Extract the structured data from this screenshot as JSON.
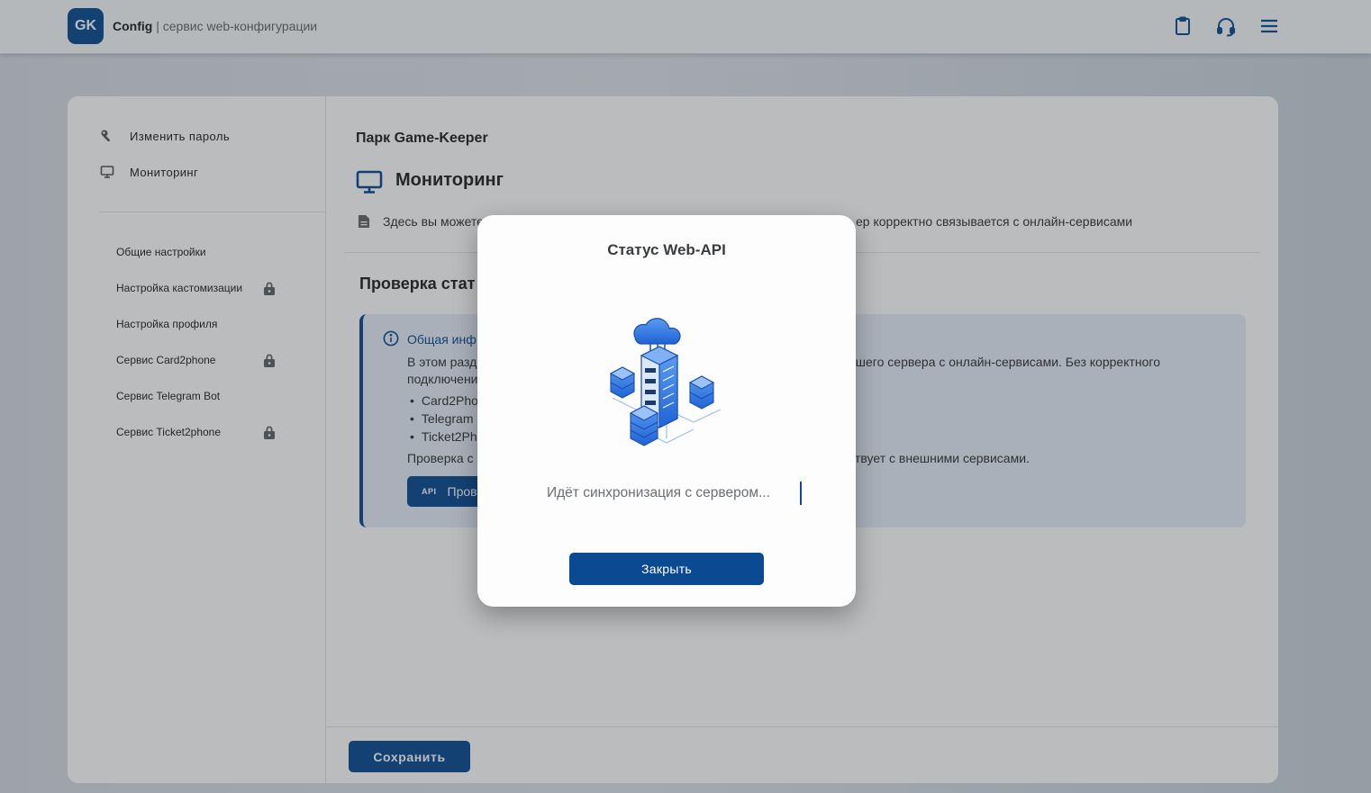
{
  "header": {
    "logo": "GK",
    "app_name": "Config",
    "app_subtitle": "| сервис web-конфигурации",
    "icons": [
      "clipboard-icon",
      "headset-icon",
      "menu-icon"
    ]
  },
  "sidebar": {
    "top_items": [
      {
        "label": "Изменить пароль",
        "icon": "wrench-icon"
      },
      {
        "label": "Мониторинг",
        "icon": "monitor-icon"
      }
    ],
    "items": [
      {
        "label": "Общие настройки",
        "locked": false
      },
      {
        "label": "Настройка кастомизации",
        "locked": true
      },
      {
        "label": "Настройка профиля",
        "locked": false
      },
      {
        "label": "Сервис Card2phone",
        "locked": true
      },
      {
        "label": "Сервис Telegram Bot",
        "locked": false
      },
      {
        "label": "Сервис Ticket2phone",
        "locked": true
      }
    ]
  },
  "main": {
    "park_title": "Парк Game-Keeper",
    "section_title": "Мониторинг",
    "description_left": "Здесь вы можете",
    "description_right": "ер корректно связывается с онлайн-сервисами",
    "check_title": "Проверка стат",
    "info": {
      "title": "Общая инф",
      "line1_left": "В этом разд",
      "line1_right": "ашего сервера с онлайн-сервисами. Без корректного",
      "line2_left": "подключени",
      "list": [
        "Card2Pho",
        "Telegram",
        "Ticket2Ph"
      ],
      "line3_left": "Проверка с",
      "line3_right": "ствует с внешними сервисами.",
      "button_badge": "API",
      "button_label": "Пров"
    }
  },
  "footer": {
    "save_label": "Сохранить"
  },
  "modal": {
    "title": "Статус Web-API",
    "status_text": "Идёт синхронизация с сервером...",
    "close_label": "Закрыть",
    "illustration": "cloud-server-network-icon"
  },
  "colors": {
    "primary": "#0b4a93",
    "info_bg": "#e7eef9",
    "lock_gray": "#5f6368"
  }
}
